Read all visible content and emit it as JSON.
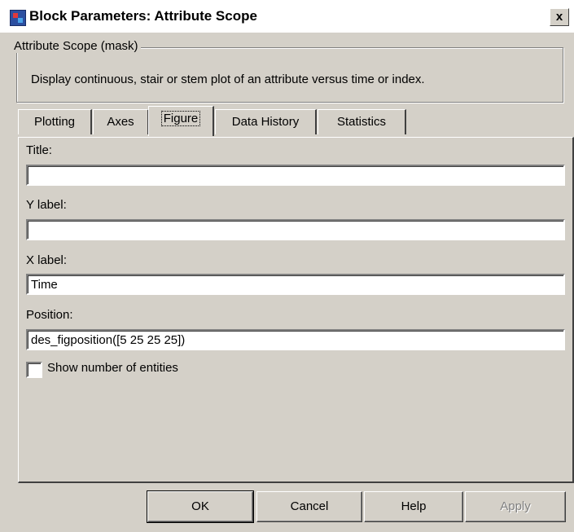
{
  "window": {
    "title": "Block Parameters: Attribute Scope",
    "close_label": "x"
  },
  "description": {
    "group_title": "Attribute Scope (mask)",
    "text": "Display continuous, stair or stem plot of an attribute versus time or index."
  },
  "tabs": [
    {
      "label": "Plotting"
    },
    {
      "label": "Axes"
    },
    {
      "label": "Figure"
    },
    {
      "label": "Data History"
    },
    {
      "label": "Statistics"
    }
  ],
  "active_tab": "Figure",
  "fields": {
    "title": {
      "label": "Title:",
      "value": ""
    },
    "ylabel": {
      "label": "Y label:",
      "value": ""
    },
    "xlabel": {
      "label": "X label:",
      "value": "Time"
    },
    "position": {
      "label": "Position:",
      "value": "des_figposition([5 25 25 25])"
    }
  },
  "checkbox": {
    "label": "Show number of entities",
    "checked": false
  },
  "buttons": {
    "ok": "OK",
    "cancel": "Cancel",
    "help": "Help",
    "apply": "Apply"
  }
}
